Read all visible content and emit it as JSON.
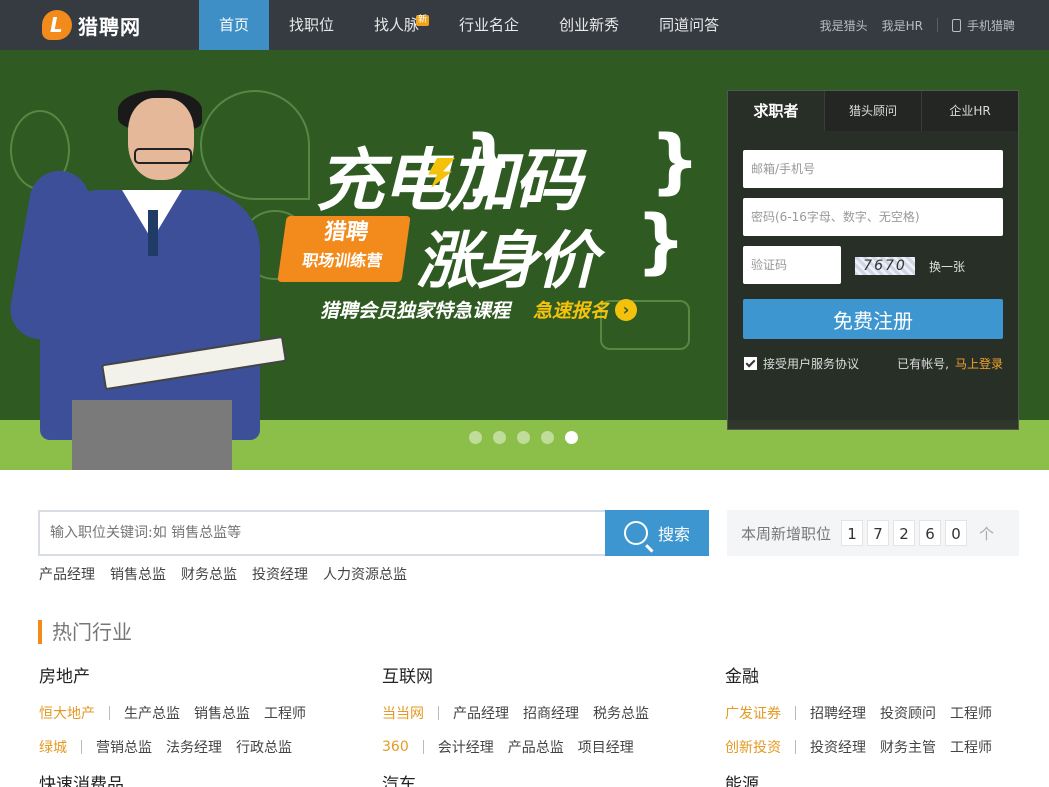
{
  "brand": {
    "name": "猎聘网",
    "logo_letter": "L"
  },
  "nav": {
    "items": [
      {
        "label": "首页",
        "active": true
      },
      {
        "label": "找职位"
      },
      {
        "label": "找人脉",
        "badge": "新"
      },
      {
        "label": "行业名企"
      },
      {
        "label": "创业新秀"
      },
      {
        "label": "同道问答"
      }
    ],
    "right": {
      "headhunter": "我是猎头",
      "hr": "我是HR",
      "mobile": "手机猎聘"
    }
  },
  "banner": {
    "headline1": "充电加码",
    "headline2": "涨身价",
    "tag_line1": "猎聘",
    "tag_line2": "职场训练营",
    "subtitle": "猎聘会员独家特急课程",
    "cta": "急速报名",
    "slide_count": 5,
    "active_slide": 5
  },
  "register": {
    "tabs": [
      "求职者",
      "猎头顾问",
      "企业HR"
    ],
    "email_placeholder": "邮箱/手机号",
    "password_placeholder": "密码(6-16字母、数字、无空格)",
    "captcha_placeholder": "验证码",
    "captcha_text": "7670",
    "captcha_refresh": "换一张",
    "submit": "免费注册",
    "agree": "接受用户服务协议",
    "have_account": "已有帐号,",
    "login_link": "马上登录",
    "colors": {
      "button": "#3d96cf",
      "link": "#f2a32b"
    }
  },
  "search": {
    "placeholder": "输入职位关键词:如 销售总监等",
    "button": "搜索",
    "hot_keywords": [
      "产品经理",
      "销售总监",
      "财务总监",
      "投资经理",
      "人力资源总监"
    ]
  },
  "weekly": {
    "label": "本周新增职位",
    "digits": [
      "1",
      "7",
      "2",
      "6",
      "0"
    ],
    "unit": "个"
  },
  "hot_industries": {
    "title": "热门行业",
    "groups": [
      {
        "name": "房地产",
        "rows": [
          {
            "company": "恒大地产",
            "jobs": [
              "生产总监",
              "销售总监",
              "工程师"
            ]
          },
          {
            "company": "绿城",
            "jobs": [
              "营销总监",
              "法务经理",
              "行政总监"
            ]
          }
        ]
      },
      {
        "name": "互联网",
        "rows": [
          {
            "company": "当当网",
            "jobs": [
              "产品经理",
              "招商经理",
              "税务总监"
            ]
          },
          {
            "company": "360",
            "jobs": [
              "会计经理",
              "产品总监",
              "项目经理"
            ]
          }
        ]
      },
      {
        "name": "金融",
        "rows": [
          {
            "company": "广发证券",
            "jobs": [
              "招聘经理",
              "投资顾问",
              "工程师"
            ]
          },
          {
            "company": "创新投资",
            "jobs": [
              "投资经理",
              "财务主管",
              "工程师"
            ]
          }
        ]
      }
    ],
    "next_groups": [
      "快速消费品",
      "汽车",
      "能源"
    ]
  }
}
